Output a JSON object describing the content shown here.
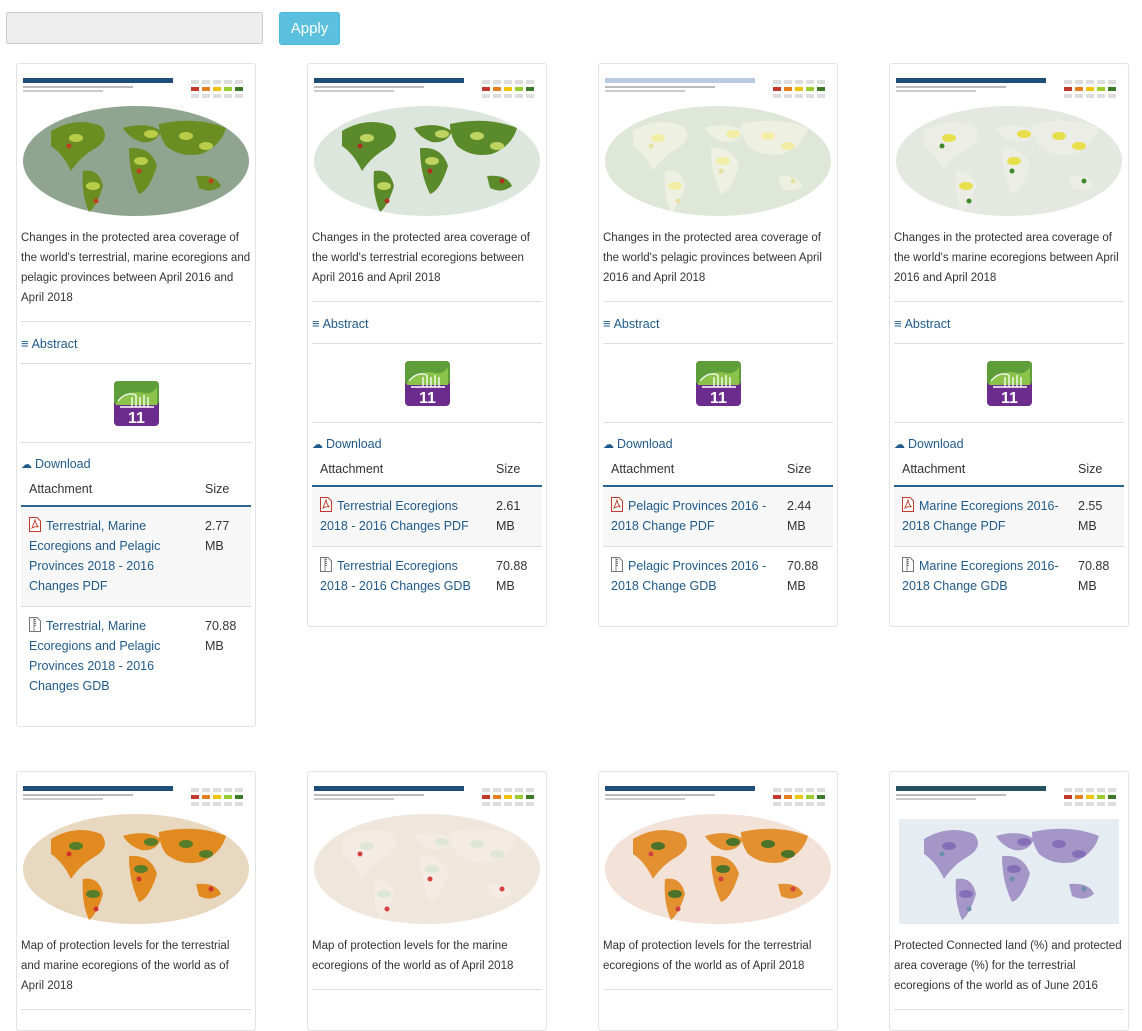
{
  "filter": {
    "value": "",
    "placeholder": ""
  },
  "apply_label": "Apply",
  "common": {
    "abstract_label": "Abstract",
    "download_label": "Download",
    "col_attachment": "Attachment",
    "col_size": "Size",
    "sdg_badge_number": "11"
  },
  "colors": {
    "accent": "#5bc0de",
    "link": "#1f5a8a",
    "sdg_purple": "#6b2c8e",
    "table_rule": "#2a6591"
  },
  "cards": [
    {
      "caption": "Changes in the protected area coverage of the world's terrestrial, marine ecoregions and pelagic provinces between April 2016 and April 2018",
      "attachments": [
        {
          "name": "Terrestrial, Marine Ecoregions and Pelagic Provinces 2018 - 2016 Changes PDF",
          "size": "2.77 MB",
          "icon": "pdf-file-icon"
        },
        {
          "name": "Terrestrial, Marine Ecoregions and Pelagic Provinces 2018 - 2016 Changes GDB",
          "size": "70.88 MB",
          "icon": "archive-file-icon"
        }
      ]
    },
    {
      "caption": "Changes in the protected area coverage of the world's terrestrial ecoregions between April 2016 and April 2018",
      "attachments": [
        {
          "name": "Terrestrial Ecoregions 2018 - 2016 Changes PDF",
          "size": "2.61 MB",
          "icon": "pdf-file-icon"
        },
        {
          "name": "Terrestrial Ecoregions 2018 - 2016 Changes GDB",
          "size": "70.88 MB",
          "icon": "archive-file-icon"
        }
      ]
    },
    {
      "caption": "Changes in the protected area coverage of the world's pelagic provinces between April 2016 and April 2018",
      "attachments": [
        {
          "name": "Pelagic Provinces 2016 - 2018 Change PDF",
          "size": "2.44 MB",
          "icon": "pdf-file-icon"
        },
        {
          "name": "Pelagic Provinces 2016 - 2018 Change GDB",
          "size": "70.88 MB",
          "icon": "archive-file-icon"
        }
      ]
    },
    {
      "caption": "Changes in the protected area coverage of the world's marine ecoregions between April 2016 and April 2018",
      "attachments": [
        {
          "name": "Marine Ecoregions 2016-2018 Change PDF",
          "size": "2.55 MB",
          "icon": "pdf-file-icon"
        },
        {
          "name": "Marine Ecoregions 2016-2018 Change GDB",
          "size": "70.88 MB",
          "icon": "archive-file-icon"
        }
      ]
    },
    {
      "caption": "Map of protection levels for the terrestrial and marine ecoregions of the world as of April 2018",
      "attachments": []
    },
    {
      "caption": "Map of protection levels for the marine ecoregions of the world as of April 2018",
      "attachments": []
    },
    {
      "caption": "Map of protection levels for the terrestrial ecoregions of the world as of April 2018",
      "attachments": []
    },
    {
      "caption": "Protected Connected land (%) and protected area coverage (%) for the terrestrial ecoregions of the world as of June 2016",
      "attachments": []
    }
  ]
}
